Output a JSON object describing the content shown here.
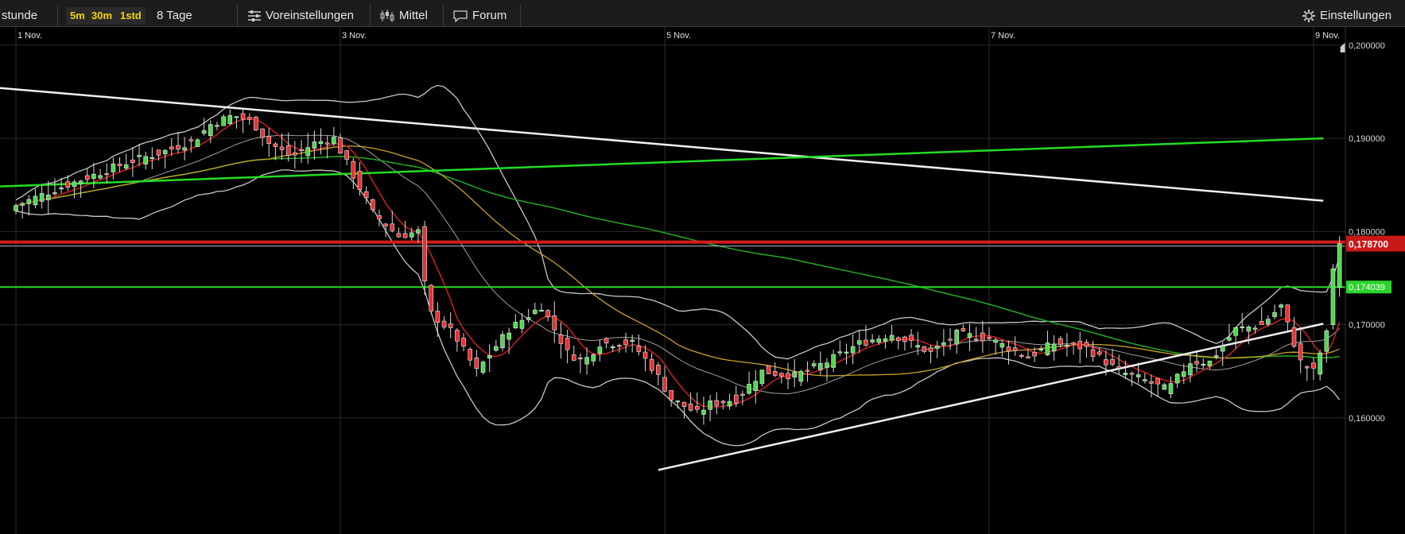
{
  "toolbar": {
    "interval_label": "stunde",
    "timeframes": [
      "5m",
      "30m",
      "1std"
    ],
    "range_label": "8 Tage",
    "presets_label": "Voreinstellungen",
    "indicator_label": "Mittel",
    "forum_label": "Forum",
    "settings_label": "Einstellungen"
  },
  "colors": {
    "background": "#000000",
    "grid": "#2b2b2b",
    "up_candle": "#4cd94c",
    "down_candle": "#e83030",
    "trendline": "#f0f0f0",
    "green_trendline": "#22dd22",
    "resistance_line": "#d41c1c",
    "support_line": "#22dd22",
    "bollinger": "#c8c8c8",
    "sma_fast": "#cc2020",
    "sma_mid": "#c9a227",
    "sma_slow": "#22aa22",
    "tf_text": "#f5d400"
  },
  "chart_data": {
    "type": "candlestick",
    "x_ticks": [
      "1 Nov.",
      "3 Nov.",
      "5 Nov.",
      "7 Nov.",
      "9 Nov."
    ],
    "y_ticks": [
      "0,200000",
      "0,190000",
      "0,180000",
      "0,170000",
      "0,160000"
    ],
    "ylim": [
      0.1535,
      0.2005
    ],
    "last_price_label": "0,178700",
    "last_price": 0.1787,
    "support_label": "0,174039",
    "support_value": 0.174039,
    "grid": true,
    "trendlines": [
      {
        "name": "falling-resistance",
        "from": [
          -8,
          0.1955
        ],
        "to": [
          403,
          0.1833
        ]
      },
      {
        "name": "rising-support",
        "from": [
          198,
          0.1544
        ],
        "to": [
          403,
          0.1701
        ]
      },
      {
        "name": "green-rising",
        "from": [
          -8,
          0.1848
        ],
        "to": [
          403,
          0.19
        ]
      }
    ],
    "candles": []
  }
}
